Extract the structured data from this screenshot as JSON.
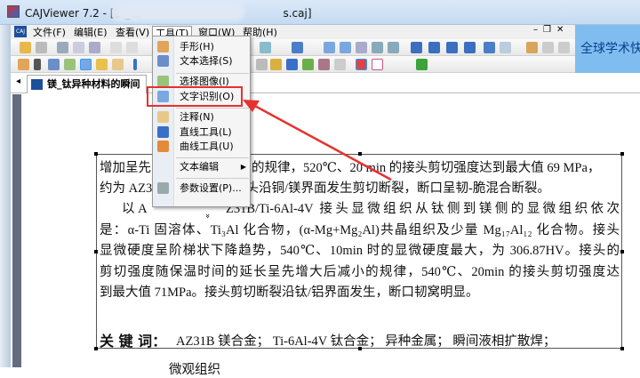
{
  "window": {
    "title": "CAJViewer 7.2 - [镁_钛",
    "title_suffix": "s.caj]"
  },
  "menubar": [
    {
      "label": "文件(F)"
    },
    {
      "label": "编辑(E)"
    },
    {
      "label": "查看(V)"
    },
    {
      "label": "工具(T)"
    },
    {
      "label": "窗口(W)"
    },
    {
      "label": "帮助(H)"
    }
  ],
  "window_controls": {
    "minimize": "–",
    "restore": "❐",
    "close": "✕"
  },
  "banner": {
    "text": "全球学术快"
  },
  "tab": {
    "label": "镁_钛异种材料的瞬间"
  },
  "tools_menu": {
    "items": [
      {
        "label": "手形(H)",
        "icon": "hand-icon"
      },
      {
        "label": "文本选择(S)",
        "icon": "text-select-icon"
      },
      {
        "label": "选择图像(I)",
        "icon": "image-select-icon"
      },
      {
        "label": "文字识别(O)",
        "icon": "ocr-icon"
      },
      {
        "label": "注释(N)",
        "icon": "annotation-icon"
      },
      {
        "label": "直线工具(L)",
        "icon": "line-tool-icon"
      },
      {
        "label": "曲线工具(U)",
        "icon": "curve-tool-icon"
      },
      {
        "label": "文本编辑",
        "icon": "submenu-arrow-icon",
        "submenu_arrow": "▶"
      },
      {
        "label": "参数设置(P)...",
        "icon": "settings-icon"
      }
    ],
    "expand": "»"
  },
  "highlight_color": "#e5322e",
  "document": {
    "line1_left": "增加呈先",
    "line1_right": "的规律，520℃、20 min 的接头剪切强度达到最大值 69 MPa，",
    "line2_left": "约为 AZ3",
    "line2_right": "接头沿铜/镁界面发生剪切断裂，断口呈韧-脆混合断裂。",
    "line3_left": "以 A",
    "line3_right": "Z31B/Ti-6Al-4V 接头显微组织从钛侧到镁侧的显微组织依次",
    "line4": "是：α-Ti 固溶体、Ti₃Al 化合物，(α-Mg+Mg₂Al)共晶组织及少量 Mg₁₇Al₁₂ 化合物。接头",
    "line5": "显微硬度呈阶梯状下降趋势，540℃、10min 时的显微硬度最大，为 306.87HV。接头的",
    "line6": "剪切强度随保温时间的延长呈先增大后减小的规律，540℃、20min 的接头剪切强度达",
    "line7": "到最大值 71MPa。接头剪切断裂沿钛/铝界面发生，断口韧窝明显。",
    "keywords_label": "关 键 词：",
    "keywords": "AZ31B 镁合金；  Ti-6Al-4V 钛合金；  异种金属；  瞬间液相扩散焊；",
    "partial_bottom": "微观组织"
  }
}
